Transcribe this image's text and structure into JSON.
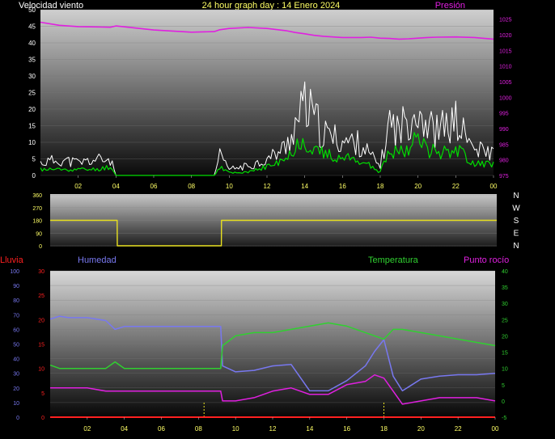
{
  "header": {
    "wind_label": "Velocidad viento",
    "title": "24 hour graph day : 14 Enero 2024",
    "pressure_label": "Presión"
  },
  "colors": {
    "background": "#000000",
    "wind_gust": "#ffffff",
    "wind_avg": "#00dd00",
    "pressure": "#e020e0",
    "direction": "#e8e020",
    "humidity": "#7878f0",
    "temperature": "#30d030",
    "dewpoint": "#e020e0",
    "rain": "#ff2020",
    "time_labels": "#ffff66"
  },
  "bottom_labels": {
    "rain": "Lluvia",
    "humidity": "Humedad",
    "temperature": "Temperatura",
    "dewpoint": "Punto rocío"
  },
  "direction_letters": [
    "N",
    "W",
    "S",
    "E",
    "N"
  ],
  "x_ticks": [
    "02",
    "04",
    "06",
    "08",
    "10",
    "12",
    "14",
    "16",
    "18",
    "20",
    "22",
    "00"
  ],
  "chart_data": [
    {
      "type": "line",
      "panel": "wind_pressure",
      "x": [
        0,
        1,
        2,
        3,
        3.7,
        4,
        6,
        8,
        9.2,
        9.5,
        10,
        11,
        12,
        13,
        13.5,
        14,
        14.5,
        15,
        16,
        17,
        17.5,
        18,
        18.5,
        19,
        19.5,
        20,
        20.5,
        21,
        22,
        23,
        24
      ],
      "series": [
        {
          "name": "Gust",
          "values": [
            4,
            5,
            4,
            5,
            5,
            0,
            0,
            0,
            0,
            6,
            2,
            3,
            5,
            9,
            16,
            22,
            18,
            13,
            11,
            10,
            6,
            3,
            17,
            14,
            19,
            22,
            16,
            14,
            17,
            8,
            7
          ]
        },
        {
          "name": "Avg",
          "values": [
            2,
            2,
            2,
            2,
            3,
            0,
            0,
            0,
            0,
            3,
            1,
            1,
            3,
            5,
            10,
            12,
            9,
            7,
            6,
            5,
            3,
            1,
            9,
            8,
            10,
            12,
            9,
            8,
            9,
            4,
            4
          ]
        },
        {
          "name": "Presión",
          "axis": "right",
          "values": [
            1024.0,
            1023.0,
            1022.6,
            1022.5,
            1022.4,
            1022.8,
            1021.5,
            1020.8,
            1021.0,
            1021.6,
            1022.0,
            1022.3,
            1022.0,
            1021.3,
            1020.7,
            1020.3,
            1019.8,
            1019.5,
            1019.1,
            1019.1,
            1019.2,
            1018.9,
            1018.8,
            1018.6,
            1018.7,
            1018.9,
            1019.1,
            1019.2,
            1019.3,
            1019.1,
            1018.6
          ]
        }
      ],
      "ylim_left": [
        0,
        50
      ],
      "yticks_left": [
        "0",
        "5",
        "10",
        "15",
        "20",
        "25",
        "30",
        "35",
        "40",
        "45",
        "50"
      ],
      "ylim_right": [
        975,
        1028
      ],
      "yticks_right": [
        "975",
        "980",
        "985",
        "990",
        "995",
        "1000",
        "1005",
        "1010",
        "1015",
        "1020",
        "1025"
      ]
    },
    {
      "type": "line",
      "panel": "direction",
      "x": [
        0,
        3.6,
        3.61,
        9.2,
        9.21,
        24
      ],
      "values": [
        180,
        180,
        0,
        0,
        180,
        180
      ],
      "ylim": [
        0,
        360
      ],
      "yticks": [
        "0",
        "90",
        "180",
        "270",
        "360"
      ]
    },
    {
      "type": "line",
      "panel": "humidity_temperature",
      "x": [
        0,
        0.5,
        1,
        2,
        3,
        3.5,
        4,
        6,
        8,
        9.2,
        9.3,
        10,
        11,
        12,
        13,
        14,
        15,
        16,
        17,
        17.5,
        18,
        18.5,
        19,
        20,
        21,
        22,
        23,
        24
      ],
      "series": [
        {
          "name": "Humedad",
          "axis": "left",
          "values": [
            67,
            69,
            68,
            68,
            66,
            60,
            62,
            62,
            62,
            62,
            35,
            31,
            32,
            35,
            36,
            18,
            18,
            25,
            35,
            45,
            53,
            28,
            18,
            26,
            28,
            29,
            29,
            30
          ]
        },
        {
          "name": "Temperatura",
          "axis": "right",
          "values": [
            11,
            10,
            10,
            10,
            10,
            12,
            10,
            10,
            10,
            10,
            17,
            20,
            21,
            21,
            22,
            23,
            24,
            23,
            21,
            20,
            19,
            22,
            22,
            21,
            20,
            19,
            18,
            17
          ]
        },
        {
          "name": "Punto rocío",
          "axis": "right",
          "values": [
            4,
            4,
            4,
            4,
            3,
            3,
            3,
            3,
            3,
            3,
            0,
            0,
            1,
            3,
            4,
            2,
            2,
            5,
            6,
            8,
            7,
            3,
            -1,
            0,
            1,
            1,
            1,
            0
          ]
        },
        {
          "name": "Lluvia",
          "axis": "rain",
          "values": [
            0,
            0,
            0,
            0,
            0,
            0,
            0,
            0,
            0,
            0,
            0,
            0,
            0,
            0,
            0,
            0,
            0,
            0,
            0,
            0,
            0,
            0,
            0,
            0,
            0,
            0,
            0,
            0
          ]
        }
      ],
      "ylim_humidity": [
        0,
        100
      ],
      "yticks_humidity": [
        "0",
        "10",
        "20",
        "30",
        "40",
        "50",
        "60",
        "70",
        "80",
        "90",
        "100"
      ],
      "ylim_rain": [
        0,
        30
      ],
      "yticks_rain": [
        "0",
        "5",
        "10",
        "15",
        "20",
        "25",
        "30"
      ],
      "ylim_temperature": [
        -5,
        40
      ],
      "yticks_temperature": [
        "-5",
        "0",
        "5",
        "10",
        "15",
        "20",
        "25",
        "30",
        "35",
        "40"
      ]
    }
  ]
}
